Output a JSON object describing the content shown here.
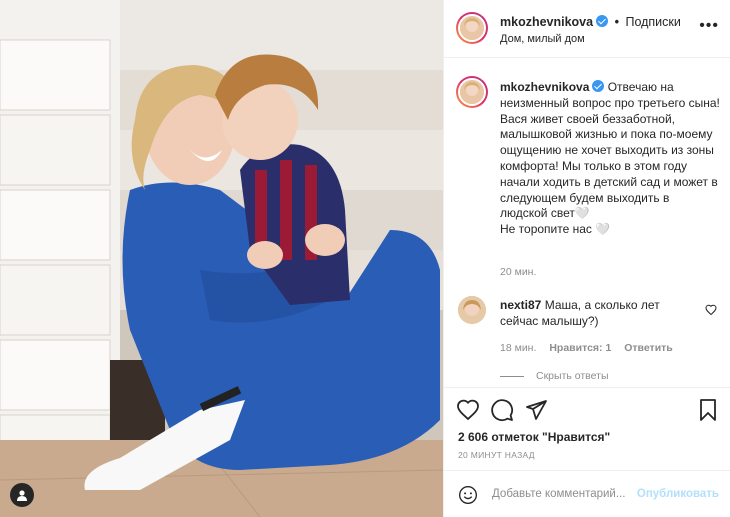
{
  "post": {
    "username": "mkozhevnikova",
    "follow_dot": "•",
    "follow_label": "Подписки",
    "location": "Дом, милый дом",
    "more_label": "•••"
  },
  "caption": {
    "username": "mkozhevnikova",
    "text": "Отвечаю на неизменный вопрос про третьего сына! Вася живет своей беззаботной, малышковой жизнью и пока по-моему ощущению не хочет выходить из зоны комфорта! Мы только в этом году начали ходить в детский сад и может в следующем будем выходить в людской свет🤍\nНе торопите нас 🤍",
    "time": "20 мин."
  },
  "comment": {
    "username": "nexti87",
    "text": "Маша, а сколько лет сейчас малышу?)",
    "time": "18 мин.",
    "likes": "Нравится: 1",
    "reply": "Ответить",
    "hide_replies": "Скрыть ответы"
  },
  "likes_text": "2 606 отметок \"Нравится\"",
  "post_time": "20 МИНУТ НАЗАД",
  "comment_input": {
    "placeholder": "Добавьте комментарий...",
    "publish": "Опубликовать"
  },
  "colors": {
    "accent_blue": "#3897f0",
    "publish_disabled": "#b2dffc",
    "secondary_text": "#8e8e8e",
    "primary_text": "#262626"
  },
  "icons": [
    "heart-icon",
    "comment-icon",
    "share-icon",
    "bookmark-icon",
    "smile-icon",
    "more-icon",
    "verified-icon",
    "user-tag-icon"
  ]
}
